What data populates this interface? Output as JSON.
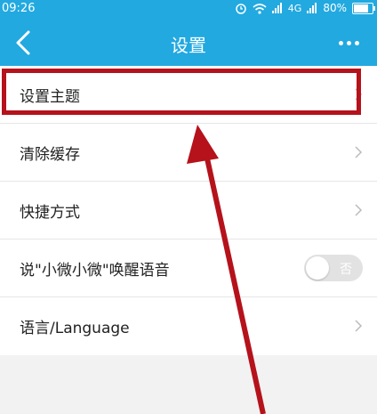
{
  "status_bar": {
    "time": "09:26",
    "network": "4G",
    "battery_percent": "80%",
    "battery_level": 0.8,
    "icons": [
      "alarm-icon",
      "wifi-icon",
      "signal-icon",
      "signal-icon",
      "battery-icon"
    ]
  },
  "nav": {
    "title": "设置",
    "back_icon": "back-chevron-icon",
    "more_icon": "more-dots-icon"
  },
  "settings": {
    "items": [
      {
        "label": "设置主题",
        "control": "chevron"
      },
      {
        "label": "清除缓存",
        "control": "chevron"
      },
      {
        "label": "快捷方式",
        "control": "chevron"
      },
      {
        "label": "说\"小微小微\"唤醒语音",
        "control": "toggle",
        "toggle_text": "否",
        "toggle_on": false
      },
      {
        "label": "语言/Language",
        "control": "chevron"
      }
    ]
  },
  "colors": {
    "header": "#22a9e0",
    "highlight": "#b5121b"
  }
}
